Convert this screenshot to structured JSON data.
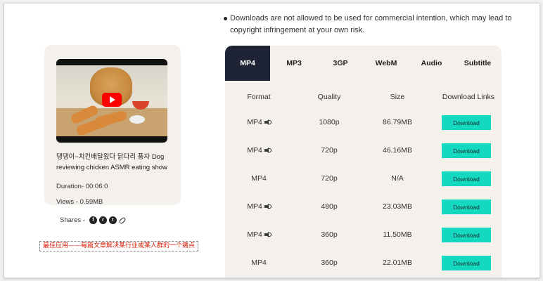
{
  "disclaimer": "Downloads are not allowed to be used for commercial intention, which may lead to copyright infringement at your own risk.",
  "video": {
    "title": "댕댕이~치킨배달왔다 닭다리 풍자 Dog reviewing chicken ASMR eating show",
    "duration": "Duration-  00:06:0",
    "views": "Views - 0.59MB",
    "shares_label": "Shares -",
    "share_icons": [
      "facebook-icon",
      "reddit-icon",
      "twitter-icon",
      "link-icon"
    ]
  },
  "note": "最佳应用——每篇文章解决某行业或某人群的一个痛点",
  "tabs": [
    "MP4",
    "MP3",
    "3GP",
    "WebM",
    "Audio",
    "Subtitle"
  ],
  "active_tab": "MP4",
  "table": {
    "headers": [
      "Format",
      "Quality",
      "Size",
      "Download Links"
    ],
    "rows": [
      {
        "format": "MP4",
        "audio": true,
        "quality": "1080p",
        "size": "86.79MB",
        "button": "Download"
      },
      {
        "format": "MP4",
        "audio": true,
        "quality": "720p",
        "size": "46.16MB",
        "button": "Download"
      },
      {
        "format": "MP4",
        "audio": false,
        "quality": "720p",
        "size": "N/A",
        "button": "Download"
      },
      {
        "format": "MP4",
        "audio": true,
        "quality": "480p",
        "size": "23.03MB",
        "button": "Download"
      },
      {
        "format": "MP4",
        "audio": true,
        "quality": "360p",
        "size": "11.50MB",
        "button": "Download"
      },
      {
        "format": "MP4",
        "audio": false,
        "quality": "360p",
        "size": "22.01MB",
        "button": "Download"
      }
    ]
  },
  "colors": {
    "download_button": "#14d9c1",
    "active_tab": "#1e2436",
    "panel_bg": "#f4f0eb",
    "note_text": "#d81e06"
  }
}
